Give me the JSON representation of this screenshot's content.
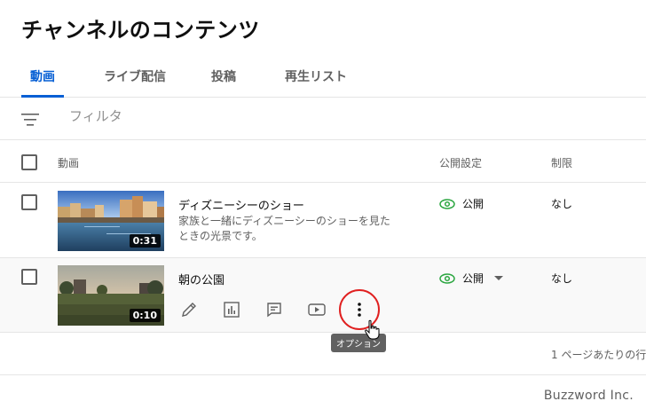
{
  "page": {
    "title": "チャンネルのコンテンツ"
  },
  "tabs": [
    {
      "label": "動画",
      "active": true
    },
    {
      "label": "ライブ配信",
      "active": false
    },
    {
      "label": "投稿",
      "active": false
    },
    {
      "label": "再生リスト",
      "active": false
    }
  ],
  "filter": {
    "icon": "filter-lines-icon",
    "placeholder": "フィルタ"
  },
  "table": {
    "columns": {
      "video": "動画",
      "visibility": "公開設定",
      "restriction": "制限"
    },
    "rows": [
      {
        "title": "ディズニーシーのショー",
        "description": "家族と一緒にディズニーシーのショーを見たときの光景です。",
        "duration": "0:31",
        "visibility": "公開",
        "restriction": "なし"
      },
      {
        "title": "朝の公園",
        "description": "",
        "duration": "0:10",
        "visibility": "公開",
        "restriction": "なし",
        "actions": [
          "pencil-icon",
          "analytics-icon",
          "comments-icon",
          "youtube-play-icon",
          "more-vert-icon"
        ]
      }
    ]
  },
  "tooltip": {
    "text": "オプション"
  },
  "pagination": {
    "rows_per_page": "1 ページあたりの行"
  },
  "watermark": {
    "text": "Buzzword Inc."
  },
  "colors": {
    "accent": "#065fd4",
    "visibility_green": "#2ba640",
    "highlight": "#e02020"
  }
}
